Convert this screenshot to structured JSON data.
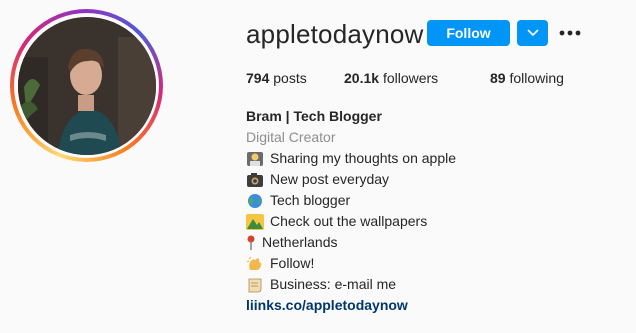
{
  "profile": {
    "username": "appletodaynow",
    "follow_label": "Follow",
    "stats": {
      "posts_count": "794",
      "posts_label": "posts",
      "followers_count": "20.1k",
      "followers_label": "followers",
      "following_count": "89",
      "following_label": "following"
    },
    "bio": {
      "full_name": "Bram | Tech Blogger",
      "category": "Digital Creator",
      "lines": [
        {
          "icon": "technologist-emoji-icon",
          "text": "Sharing my thoughts on apple"
        },
        {
          "icon": "camera-emoji-icon",
          "text": "New post everyday"
        },
        {
          "icon": "globe-emoji-icon",
          "text": "Tech blogger"
        },
        {
          "icon": "mountain-emoji-icon",
          "text": "Check out the wallpapers"
        },
        {
          "icon": "pushpin-emoji-icon",
          "text": "Netherlands"
        },
        {
          "icon": "clap-emoji-icon",
          "text": "Follow!"
        },
        {
          "icon": "scroll-emoji-icon",
          "text": "Business: e-mail me"
        }
      ],
      "link": "liinks.co/appletodaynow"
    }
  },
  "colors": {
    "accent": "#0095f6",
    "link": "#00376b",
    "muted": "#8e8e8e",
    "text": "#262626"
  }
}
